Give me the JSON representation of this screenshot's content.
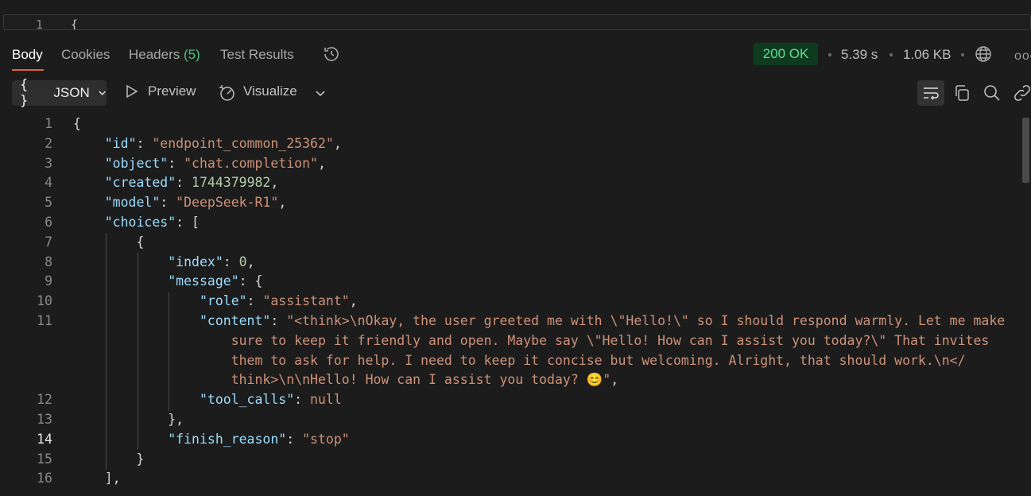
{
  "top_editor": {
    "line_number": "1",
    "code": "{"
  },
  "tabs": {
    "body": "Body",
    "cookies": "Cookies",
    "headers": "Headers",
    "headers_count": "(5)",
    "test_results": "Test Results"
  },
  "status": {
    "code": "200 OK",
    "time": "5.39 s",
    "size": "1.06 KB",
    "color_ok": "#5fe08d",
    "more": "ooo"
  },
  "toolbar": {
    "format_braces": "{ }",
    "format_label": "JSON",
    "preview": "Preview",
    "visualize": "Visualize"
  },
  "code": {
    "line_numbers": [
      "1",
      "2",
      "3",
      "4",
      "5",
      "6",
      "7",
      "8",
      "9",
      "10",
      "11",
      "12",
      "13",
      "14",
      "15",
      "16"
    ],
    "l1": "{",
    "id_key": "\"id\"",
    "id_val": "\"endpoint_common_25362\"",
    "object_key": "\"object\"",
    "object_val": "\"chat.completion\"",
    "created_key": "\"created\"",
    "created_val": "1744379982",
    "model_key": "\"model\"",
    "model_val": "\"DeepSeek-R1\"",
    "choices_key": "\"choices\"",
    "index_key": "\"index\"",
    "index_val": "0",
    "message_key": "\"message\"",
    "role_key": "\"role\"",
    "role_val": "\"assistant\"",
    "content_key": "\"content\"",
    "content_line1": "\"<think>\\nOkay, the user greeted me with \\\"Hello!\\\" so I should respond warmly. Let me make",
    "content_line2": "sure to keep it friendly and open. Maybe say \\\"Hello! How can I assist you today?\\\" That invites",
    "content_line3": "them to ask for help. I need to keep it concise but welcoming. Alright, that should work.\\n</",
    "content_line4": "think>\\n\\nHello! How can I assist you today? 😊\"",
    "tool_calls_key": "\"tool_calls\"",
    "tool_calls_val": "null",
    "finish_key": "\"finish_reason\"",
    "finish_val": "\"stop\""
  }
}
